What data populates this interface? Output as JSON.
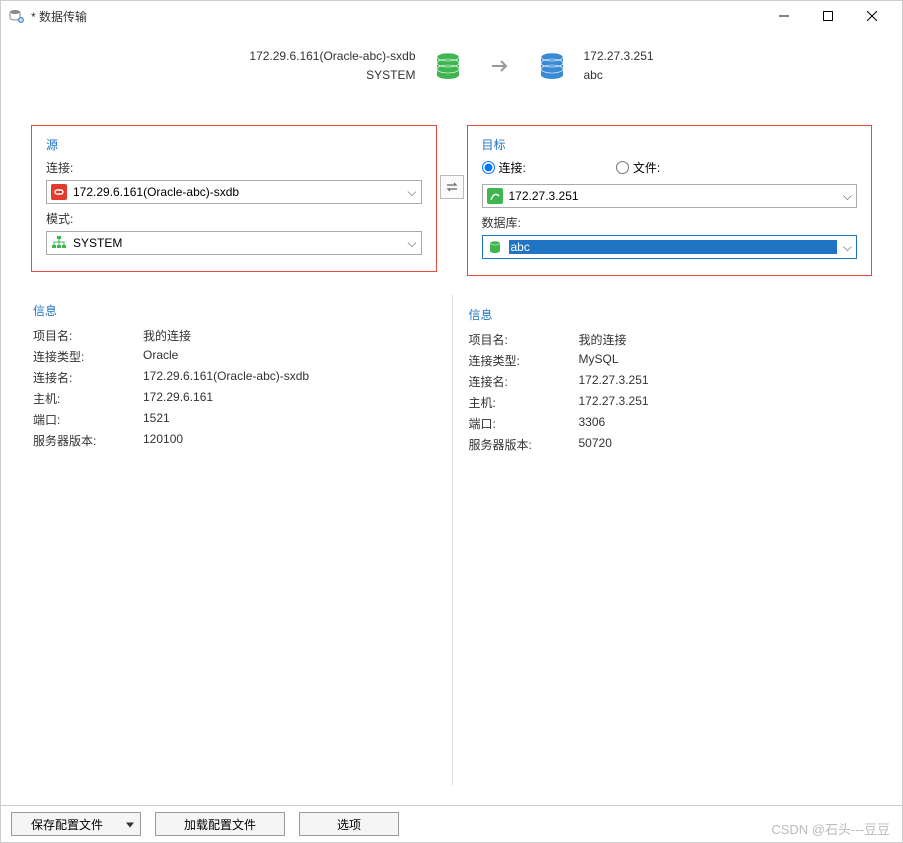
{
  "window": {
    "title": "* 数据传输"
  },
  "header": {
    "source_line1": "172.29.6.161(Oracle-abc)-sxdb",
    "source_line2": "SYSTEM",
    "target_line1": "172.27.3.251",
    "target_line2": "abc"
  },
  "source_panel": {
    "title": "源",
    "connection_label": "连接:",
    "connection_value": "172.29.6.161(Oracle-abc)-sxdb",
    "mode_label": "模式:",
    "mode_value": "SYSTEM"
  },
  "target_panel": {
    "title": "目标",
    "radio_connection": "连接:",
    "radio_file": "文件:",
    "connection_value": "172.27.3.251",
    "database_label": "数据库:",
    "database_value": "abc"
  },
  "source_info": {
    "title": "信息",
    "rows": [
      {
        "label": "项目名:",
        "value": "我的连接"
      },
      {
        "label": "连接类型:",
        "value": "Oracle"
      },
      {
        "label": "连接名:",
        "value": "172.29.6.161(Oracle-abc)-sxdb"
      },
      {
        "label": "主机:",
        "value": "172.29.6.161"
      },
      {
        "label": "端口:",
        "value": "1521"
      },
      {
        "label": "服务器版本:",
        "value": "120100"
      }
    ]
  },
  "target_info": {
    "title": "信息",
    "rows": [
      {
        "label": "项目名:",
        "value": "我的连接"
      },
      {
        "label": "连接类型:",
        "value": "MySQL"
      },
      {
        "label": "连接名:",
        "value": "172.27.3.251"
      },
      {
        "label": "主机:",
        "value": "172.27.3.251"
      },
      {
        "label": "端口:",
        "value": "3306"
      },
      {
        "label": "服务器版本:",
        "value": "50720"
      }
    ]
  },
  "footer": {
    "save_profile": "保存配置文件",
    "load_profile": "加载配置文件",
    "options": "选项"
  },
  "watermark": "CSDN @石头---豆豆"
}
